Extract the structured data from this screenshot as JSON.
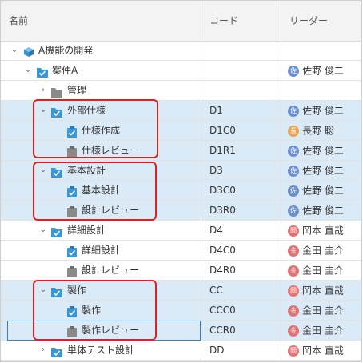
{
  "columns": {
    "name": "名前",
    "code": "コード",
    "leader": "リーダー"
  },
  "rows": [
    {
      "label": "A機能の開発",
      "code": "",
      "leader": "",
      "avatar": "",
      "avatar_color": ""
    },
    {
      "label": "案件A",
      "code": "",
      "leader": "佐野 俊二",
      "avatar": "佐",
      "avatar_color": "#6b8fcf"
    },
    {
      "label": "管理",
      "code": "",
      "leader": "",
      "avatar": "",
      "avatar_color": ""
    },
    {
      "label": "外部仕様",
      "code": "D1",
      "leader": "佐野 俊二",
      "avatar": "佐",
      "avatar_color": "#6b8fcf"
    },
    {
      "label": "仕様作成",
      "code": "D1C0",
      "leader": "長野 聡",
      "avatar": "長",
      "avatar_color": "#e8a654"
    },
    {
      "label": "仕様レビュー",
      "code": "D1R1",
      "leader": "佐野 俊二",
      "avatar": "佐",
      "avatar_color": "#6b8fcf"
    },
    {
      "label": "基本設計",
      "code": "D3",
      "leader": "佐野 俊二",
      "avatar": "佐",
      "avatar_color": "#6b8fcf"
    },
    {
      "label": "基本設計",
      "code": "D3C0",
      "leader": "佐野 俊二",
      "avatar": "佐",
      "avatar_color": "#6b8fcf"
    },
    {
      "label": "設計レビュー",
      "code": "D3R0",
      "leader": "佐野 俊二",
      "avatar": "佐",
      "avatar_color": "#6b8fcf"
    },
    {
      "label": "詳細設計",
      "code": "D4",
      "leader": "岡本 直哉",
      "avatar": "岡",
      "avatar_color": "#e57373"
    },
    {
      "label": "詳細設計",
      "code": "D4C0",
      "leader": "金田 圭介",
      "avatar": "金",
      "avatar_color": "#e57373"
    },
    {
      "label": "設計レビュー",
      "code": "D4R0",
      "leader": "金田 圭介",
      "avatar": "金",
      "avatar_color": "#e57373"
    },
    {
      "label": "製作",
      "code": "CC",
      "leader": "岡本 直哉",
      "avatar": "岡",
      "avatar_color": "#e57373"
    },
    {
      "label": "製作",
      "code": "CCC0",
      "leader": "金田 圭介",
      "avatar": "金",
      "avatar_color": "#e57373"
    },
    {
      "label": "製作レビュー",
      "code": "CCR0",
      "leader": "金田 圭介",
      "avatar": "金",
      "avatar_color": "#e57373"
    },
    {
      "label": "単体テスト設計",
      "code": "DD",
      "leader": "岡本 直哉",
      "avatar": "岡",
      "avatar_color": "#e57373"
    }
  ],
  "colors": {
    "selected_row": "#dbeaf7",
    "highlight_box": "#e02020",
    "folder_blue": "#3a97d6",
    "folder_gray": "#8a8a8a",
    "task_blue": "#3a97d6",
    "task_gray": "#8a8a8a"
  }
}
